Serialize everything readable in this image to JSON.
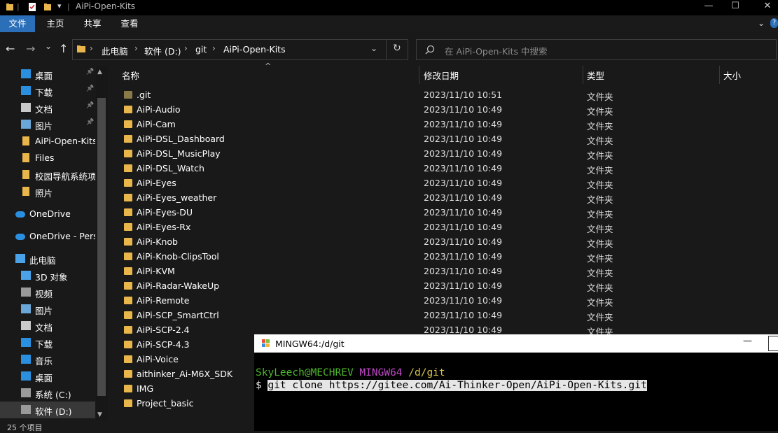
{
  "titlebar": {
    "title": "AiPi-Open-Kits",
    "minimize": "—",
    "maximize": "☐",
    "close": "✕"
  },
  "ribbon": {
    "tabs": [
      "文件",
      "主页",
      "共享",
      "查看"
    ],
    "help": "?"
  },
  "nav": {
    "back": "←",
    "forward": "→",
    "recent": "⌄",
    "up": "↑",
    "breadcrumb": [
      "此电脑",
      "软件 (D:)",
      "git",
      "AiPi-Open-Kits"
    ],
    "search_placeholder": "在 AiPi-Open-Kits 中搜索"
  },
  "sidebar": {
    "items": [
      {
        "label": "桌面",
        "icon": "desktop-icon",
        "pinned": true
      },
      {
        "label": "下载",
        "icon": "download-icon",
        "pinned": true
      },
      {
        "label": "文档",
        "icon": "document-icon",
        "pinned": true
      },
      {
        "label": "图片",
        "icon": "picture-icon",
        "pinned": true
      },
      {
        "label": "AiPi-Open-Kits",
        "icon": "folder-icon",
        "pinned": false
      },
      {
        "label": "Files",
        "icon": "folder-icon",
        "pinned": false
      },
      {
        "label": "校园导航系统项",
        "icon": "folder-icon",
        "pinned": false
      },
      {
        "label": "照片",
        "icon": "folder-icon",
        "pinned": false
      },
      {
        "label": "OneDrive",
        "icon": "cloud-icon",
        "pinned": false
      },
      {
        "label": "OneDrive - Perso",
        "icon": "cloud-icon",
        "pinned": false
      },
      {
        "label": "此电脑",
        "icon": "computer-icon",
        "pinned": false
      },
      {
        "label": "3D 对象",
        "icon": "3d-objects-icon",
        "pinned": false
      },
      {
        "label": "视频",
        "icon": "video-icon",
        "pinned": false
      },
      {
        "label": "图片",
        "icon": "picture-icon",
        "pinned": false
      },
      {
        "label": "文档",
        "icon": "document-icon",
        "pinned": false
      },
      {
        "label": "下载",
        "icon": "download-icon",
        "pinned": false
      },
      {
        "label": "音乐",
        "icon": "music-icon",
        "pinned": false
      },
      {
        "label": "桌面",
        "icon": "desktop-icon",
        "pinned": false
      },
      {
        "label": "系统 (C:)",
        "icon": "drive-icon",
        "pinned": false
      },
      {
        "label": "软件 (D:)",
        "icon": "drive-icon",
        "pinned": false
      }
    ]
  },
  "columns": {
    "name": "名称",
    "modified": "修改日期",
    "type": "类型",
    "size": "大小"
  },
  "files": [
    {
      "name": ".git",
      "modified": "2023/11/10 10:51",
      "type": "文件夹"
    },
    {
      "name": "AiPi-Audio",
      "modified": "2023/11/10 10:49",
      "type": "文件夹"
    },
    {
      "name": "AiPi-Cam",
      "modified": "2023/11/10 10:49",
      "type": "文件夹"
    },
    {
      "name": "AiPi-DSL_Dashboard",
      "modified": "2023/11/10 10:49",
      "type": "文件夹"
    },
    {
      "name": "AiPi-DSL_MusicPlay",
      "modified": "2023/11/10 10:49",
      "type": "文件夹"
    },
    {
      "name": "AiPi-DSL_Watch",
      "modified": "2023/11/10 10:49",
      "type": "文件夹"
    },
    {
      "name": "AiPi-Eyes",
      "modified": "2023/11/10 10:49",
      "type": "文件夹"
    },
    {
      "name": "AiPi-Eyes_weather",
      "modified": "2023/11/10 10:49",
      "type": "文件夹"
    },
    {
      "name": "AiPi-Eyes-DU",
      "modified": "2023/11/10 10:49",
      "type": "文件夹"
    },
    {
      "name": "AiPi-Eyes-Rx",
      "modified": "2023/11/10 10:49",
      "type": "文件夹"
    },
    {
      "name": "AiPi-Knob",
      "modified": "2023/11/10 10:49",
      "type": "文件夹"
    },
    {
      "name": "AiPi-Knob-ClipsTool",
      "modified": "2023/11/10 10:49",
      "type": "文件夹"
    },
    {
      "name": "AiPi-KVM",
      "modified": "2023/11/10 10:49",
      "type": "文件夹"
    },
    {
      "name": "AiPi-Radar-WakeUp",
      "modified": "2023/11/10 10:49",
      "type": "文件夹"
    },
    {
      "name": "AiPi-Remote",
      "modified": "2023/11/10 10:49",
      "type": "文件夹"
    },
    {
      "name": "AiPi-SCP_SmartCtrl",
      "modified": "2023/11/10 10:49",
      "type": "文件夹"
    },
    {
      "name": "AiPi-SCP-2.4",
      "modified": "2023/11/10 10:49",
      "type": "文件夹"
    },
    {
      "name": "AiPi-SCP-4.3",
      "modified": "",
      "type": ""
    },
    {
      "name": "AiPi-Voice",
      "modified": "",
      "type": ""
    },
    {
      "name": "aithinker_Ai-M6X_SDK",
      "modified": "",
      "type": ""
    },
    {
      "name": "IMG",
      "modified": "",
      "type": ""
    },
    {
      "name": "Project_basic",
      "modified": "",
      "type": ""
    }
  ],
  "status": {
    "item_count": "25 个项目"
  },
  "terminal": {
    "title": "MINGW64:/d/git",
    "prompt_user": "SkyLeech@MECHREV",
    "prompt_env": "MINGW64",
    "prompt_path": "/d/git",
    "prompt_symbol": "$",
    "command": "git clone https://gitee.com/Ai-Thinker-Open/AiPi-Open-Kits.git"
  }
}
